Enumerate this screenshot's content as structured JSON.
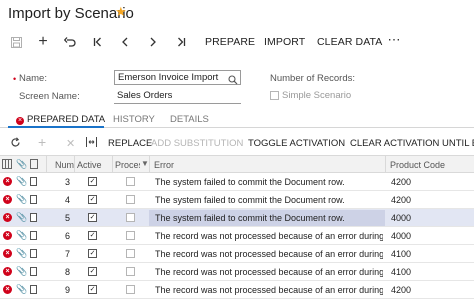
{
  "title": "Import by Scenario",
  "toolbar": {
    "prepare": "PREPARE",
    "import": "IMPORT",
    "clear_data": "CLEAR DATA"
  },
  "form": {
    "name_label": "Name:",
    "name_value": "Emerson Invoice Import",
    "screen_name_label": "Screen Name:",
    "screen_name_value": "Sales Orders",
    "number_of_records_label": "Number of Records:",
    "simple_scenario_label": "Simple Scenario"
  },
  "tabs": [
    "PREPARED DATA",
    "HISTORY",
    "DETAILS"
  ],
  "grid_toolbar": {
    "replace": "REPLACE",
    "add_substitution": "ADD SUBSTITUTION",
    "toggle_activation": "TOGGLE ACTIVATION",
    "clear_activation": "CLEAR ACTIVATION UNTIL ERR"
  },
  "columns": {
    "num": "Num",
    "active": "Active",
    "processed": "Proces",
    "error": "Error",
    "product_code": "Product Code"
  },
  "rows": [
    {
      "num": "3",
      "active": true,
      "processed": false,
      "error": "The system failed to commit the Document row.",
      "product_code": "4200"
    },
    {
      "num": "4",
      "active": true,
      "processed": false,
      "error": "The system failed to commit the Document row.",
      "product_code": "4200"
    },
    {
      "num": "5",
      "active": true,
      "processed": false,
      "error": "The system failed to commit the Document row.",
      "product_code": "4000"
    },
    {
      "num": "6",
      "active": true,
      "processed": false,
      "error": "The record was not processed because of an error during ...",
      "product_code": "4000"
    },
    {
      "num": "7",
      "active": true,
      "processed": false,
      "error": "The record was not processed because of an error during ...",
      "product_code": "4100"
    },
    {
      "num": "8",
      "active": true,
      "processed": false,
      "error": "The record was not processed because of an error during ...",
      "product_code": "4100"
    },
    {
      "num": "9",
      "active": true,
      "processed": false,
      "error": "The record was not processed because of an error during ...",
      "product_code": "4200"
    }
  ],
  "selected_row_index": 2,
  "colors": {
    "accent": "#1a73c9",
    "error": "#d0021b",
    "selected_row": "#e2e6f3",
    "star": "#f5a623"
  }
}
